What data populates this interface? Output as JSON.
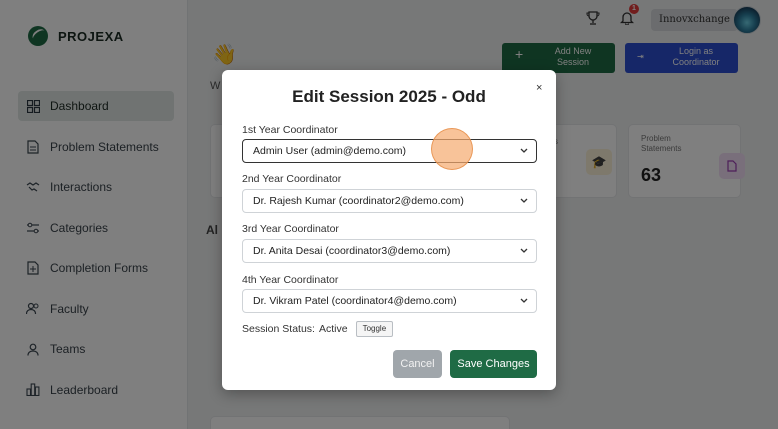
{
  "brand": {
    "name": "PROJEXA"
  },
  "sidebar": {
    "items": [
      {
        "label": "Dashboard",
        "icon": "grid-icon",
        "active": true
      },
      {
        "label": "Problem Statements",
        "icon": "document-icon"
      },
      {
        "label": "Interactions",
        "icon": "handshake-icon"
      },
      {
        "label": "Categories",
        "icon": "sliders-icon"
      },
      {
        "label": "Completion Forms",
        "icon": "plus-document-icon"
      },
      {
        "label": "Faculty",
        "icon": "users-icon"
      },
      {
        "label": "Teams",
        "icon": "user-icon"
      },
      {
        "label": "Leaderboard",
        "icon": "bar-chart-icon"
      }
    ]
  },
  "header": {
    "user": "Innovxchange",
    "notification_count": "1"
  },
  "background": {
    "add_session": "Add New Session",
    "login_as": "Login as Coordinator",
    "card_problem_label": "Problem Statements",
    "card_problem_value": "63",
    "welcome_fragment": "W",
    "section_fragment": "Al",
    "card_fragment": "s"
  },
  "modal": {
    "title": "Edit Session 2025 - Odd",
    "close": "×",
    "fields": [
      {
        "label": "1st Year Coordinator",
        "value": "Admin User (admin@demo.com)"
      },
      {
        "label": "2nd Year Coordinator",
        "value": "Dr. Rajesh Kumar (coordinator2@demo.com)"
      },
      {
        "label": "3rd Year Coordinator",
        "value": "Dr. Anita Desai (coordinator3@demo.com)"
      },
      {
        "label": "4th Year Coordinator",
        "value": "Dr. Vikram Patel (coordinator4@demo.com)"
      }
    ],
    "status_label": "Session Status:",
    "status_value": "Active",
    "toggle": "Toggle",
    "cancel": "Cancel",
    "save": "Save Changes"
  },
  "colors": {
    "brand_green": "#1f6b45",
    "login_blue": "#2c4fd1",
    "badge_red": "#e23b3b"
  }
}
